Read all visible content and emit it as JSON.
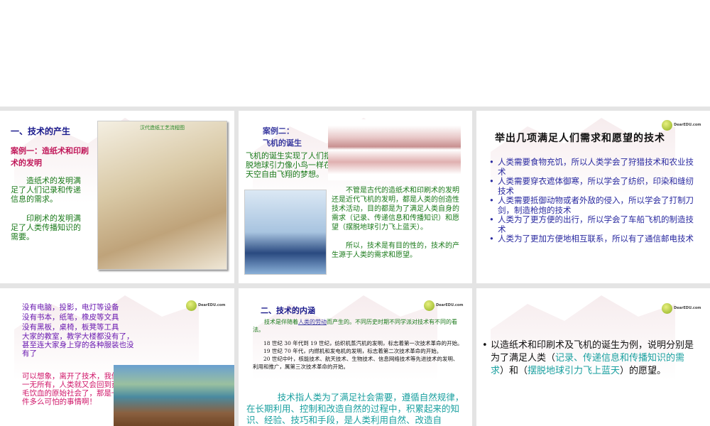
{
  "slides": [
    {
      "title": "一、技术的产生",
      "subtitle": "案例一：造纸术和印刷术的发明",
      "para1": "造纸术的发明满足了人们记录和传递信息的需求。",
      "para2": "印刷术的发明满足了人类传播知识的需要。",
      "image_caption": "汉代造纸工艺流程图"
    },
    {
      "title_line1": "案例二：",
      "title_line2": "飞机的诞生",
      "intro": "飞机的诞生实现了人们摆脱地球引力像小鸟一样在天空自由飞翔的梦想。",
      "para1": "不管是古代的造纸术和印刷术的发明还是近代飞机的发明，都是人类的创造性技术活动，目的都是为了满足人类自身的需求（记录、传递信息和传播知识）和愿望（摆脱地球引力飞上蓝天）。",
      "para2": "所以，技术是有目的性的，技术的产生源于人类的需求和愿望。"
    },
    {
      "title": "举出几项满足人们需求和愿望的技术",
      "bullets": [
        "人类需要食物充饥，所以人类学会了狩猎技术和农业技术",
        "人类需要穿衣遮体御寒，所以学会了纺织，印染和缝纫技术",
        "人类需要抵御动物或者外敌的侵入，所以学会了打制刀剑，制造枪炮的技术",
        "人类为了更方便的出行，所以学会了车船飞机的制造技术",
        "人类为了更加方便地相互联系，所以有了通信邮电技术"
      ],
      "logo": "DearEDU.com"
    },
    {
      "lines": [
        "没有电脑，投影，电灯等设备",
        "没有书本，纸笔，橡皮等文具",
        "没有黑板，桌椅，板凳等工具",
        "大家的教室，教学大楼都没有了，甚至连大家身上穿的各种服装也没有了"
      ],
      "conclusion": "可以想象，离开了技术，我们一无所有，人类就又会回到茹毛饮血的原始社会了，那是一件多么可怕的事情啊！",
      "logo": "DearEDU.com"
    },
    {
      "title": "二、技术的内涵",
      "intro_pre": "技术是伴随着",
      "intro_link": "人类的劳动",
      "intro_post": "而产生的。不同历史时期不同学派对技术有不同的看法。",
      "rev1": "18 世纪 30 年代到 19 世纪，纺织机蒸汽机的发明，标志着第一次技术革命的开始。",
      "rev2": "19 世纪 70 年代，内燃机和发电机的发明，标志着第二次技术革命的开始。",
      "rev3": "20 世纪中叶，核能技术、航天技术、生物技术、信息网络技术等先进技术的发明、利用和推广，属第三次技术革命的开始。",
      "definition": "技术指人类为了满足社会需要，遵循自然规律，在长期利用、控制和改造自然的过程中，积累起来的知识、经验、技巧和手段，是人类利用自然、改造自",
      "logo": "DearEDU.com"
    },
    {
      "bullet_pre": "以造纸术和印刷术及飞机的诞生为例，说明分别是为了满足人类（",
      "need": "记录、传递信息和传播知识的需求",
      "mid": "）和（",
      "wish": "摆脱地球引力飞上蓝天",
      "post": "）的愿望。",
      "logo": "DearEDU.com"
    }
  ]
}
